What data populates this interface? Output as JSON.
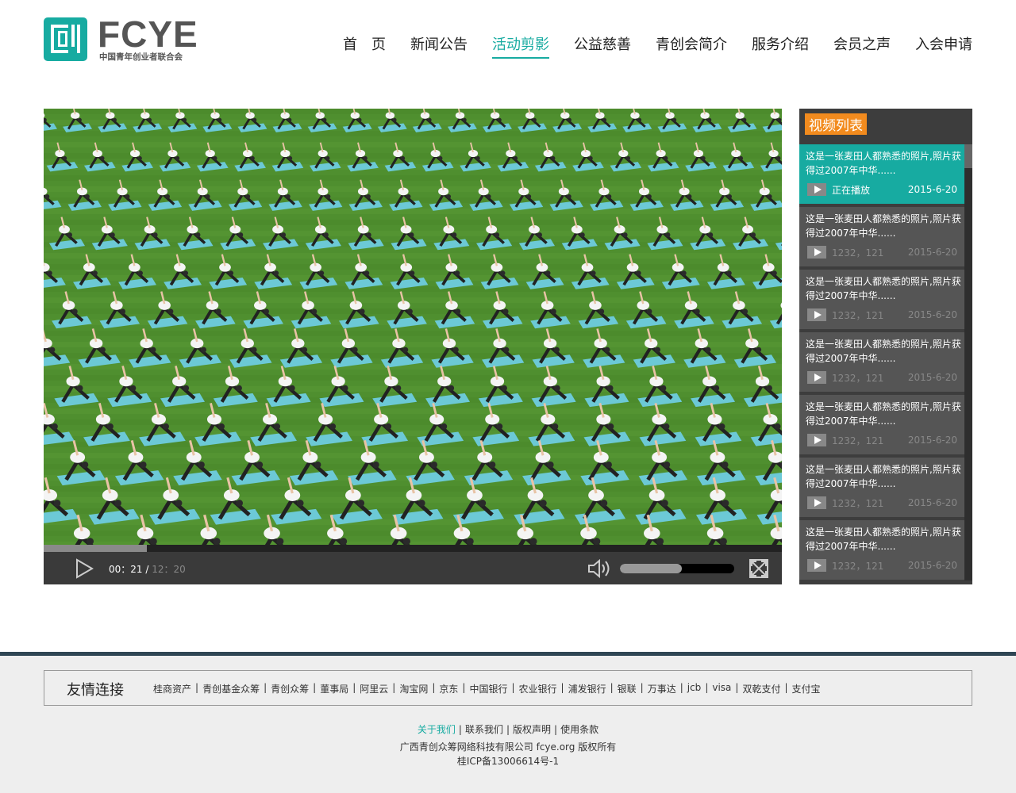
{
  "brand": {
    "name": "FCYE",
    "subtitle": "中国青年创业者联合会",
    "accent": "#17aba1"
  },
  "nav": [
    {
      "label": "首　页",
      "active": false
    },
    {
      "label": "新闻公告",
      "active": false
    },
    {
      "label": "活动剪影",
      "active": true
    },
    {
      "label": "公益慈善",
      "active": false
    },
    {
      "label": "青创会简介",
      "active": false
    },
    {
      "label": "服务介绍",
      "active": false
    },
    {
      "label": "会员之声",
      "active": false
    },
    {
      "label": "入会申请",
      "active": false
    }
  ],
  "player": {
    "current_time": "00：21 /",
    "total_time": " 12：20",
    "progress": 0.14,
    "volume": 0.54
  },
  "playlist": {
    "title": "视频列表",
    "items": [
      {
        "text": "这是一张麦田人都熟悉的照片,照片获得过2007年中华......",
        "meta": "正在播放",
        "date": "2015-6-20",
        "current": true
      },
      {
        "text": "这是一张麦田人都熟悉的照片,照片获得过2007年中华......",
        "meta": "1232，121",
        "date": "2015-6-20",
        "current": false
      },
      {
        "text": "这是一张麦田人都熟悉的照片,照片获得过2007年中华......",
        "meta": "1232，121",
        "date": "2015-6-20",
        "current": false
      },
      {
        "text": "这是一张麦田人都熟悉的照片,照片获得过2007年中华......",
        "meta": "1232，121",
        "date": "2015-6-20",
        "current": false
      },
      {
        "text": "这是一张麦田人都熟悉的照片,照片获得过2007年中华......",
        "meta": "1232，121",
        "date": "2015-6-20",
        "current": false
      },
      {
        "text": "这是一张麦田人都熟悉的照片,照片获得过2007年中华......",
        "meta": "1232，121",
        "date": "2015-6-20",
        "current": false
      },
      {
        "text": "这是一张麦田人都熟悉的照片,照片获得过2007年中华......",
        "meta": "1232，121",
        "date": "2015-6-20",
        "current": false
      }
    ]
  },
  "footer": {
    "links_title": "友情连接",
    "links": [
      "桂商资产",
      "青创基金众筹",
      "青创众筹",
      "董事局",
      "阿里云",
      "淘宝网",
      "京东",
      "中国银行",
      "农业银行",
      "浦发银行",
      "银联",
      "万事达",
      "jcb",
      "visa",
      "双乾支付",
      "支付宝"
    ],
    "bottom_nav": [
      {
        "label": "关于我们",
        "active": true
      },
      {
        "label": "联系我们",
        "active": false
      },
      {
        "label": "版权声明",
        "active": false
      },
      {
        "label": "使用条款",
        "active": false
      }
    ],
    "copyright": "广西青创众筹网络科技有限公司 fcye.org 版权所有",
    "icp": "桂ICP备13006614号-1"
  }
}
